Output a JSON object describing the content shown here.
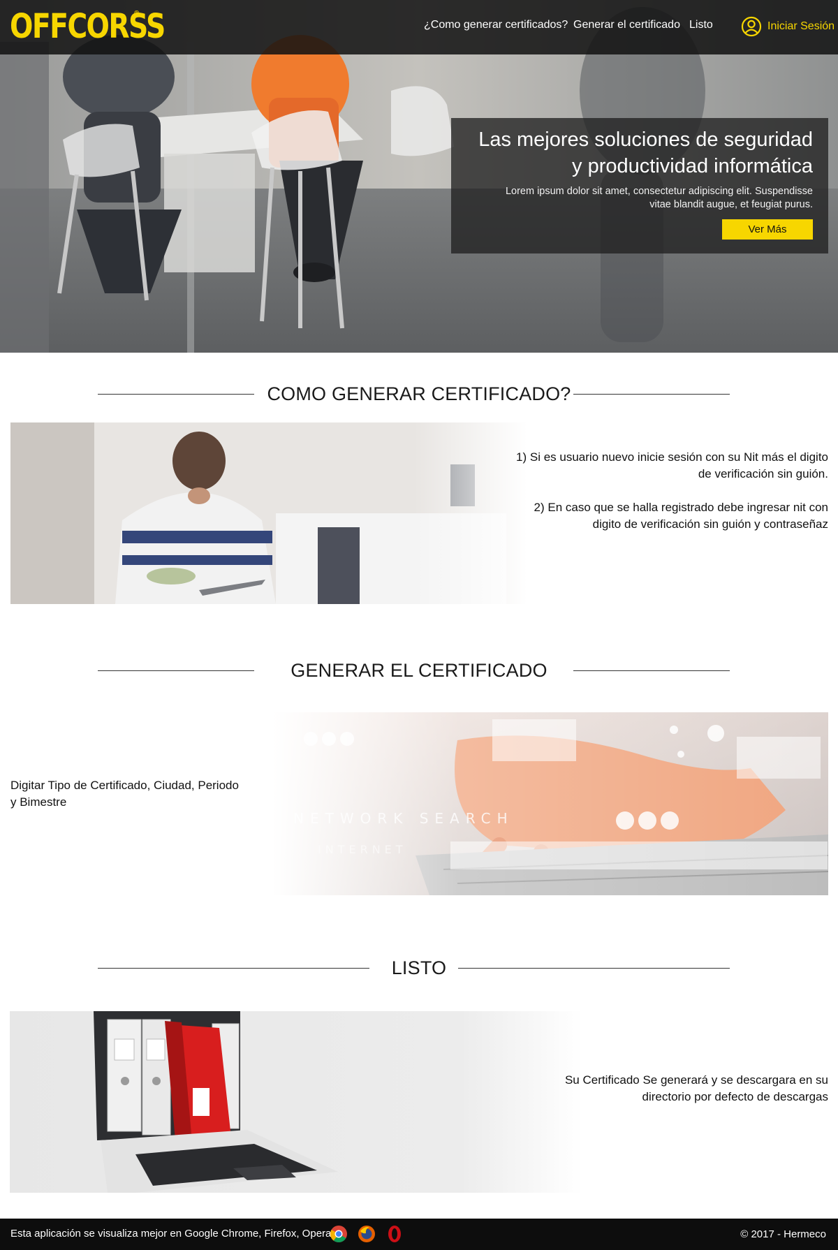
{
  "brand": {
    "logo_text": "OFFCORSS",
    "color": "#f7d600"
  },
  "nav": {
    "items": [
      {
        "label": "¿Como generar certificados?"
      },
      {
        "label": "Generar el certificado"
      },
      {
        "label": "Listo"
      }
    ],
    "login_label": "Iniciar Sesión",
    "login_icon": "user-circle-icon"
  },
  "hero": {
    "title": "Las mejores soluciones de seguridad y productividad informática",
    "text": "Lorem ipsum dolor sit amet, consectetur adipiscing elit. Suspendisse vitae blandit augue, et feugiat purus.",
    "button_label": "Ver Más"
  },
  "sections": {
    "how": {
      "title": "COMO GENERAR CERTIFICADO?",
      "step1": "1) Si es usuario nuevo inicie sesión con su Nit más el digito de verificación sin guión.",
      "step2": "2) En caso que se halla registrado debe ingresar nit con digito de verificación sin guión y contraseñaz"
    },
    "generate": {
      "title": "GENERAR EL CERTIFICADO",
      "text": "Digitar Tipo de Certificado, Ciudad, Periodo y Bimestre",
      "image_label": "NETWORK SEARCH",
      "image_sublabel": "INTERNET"
    },
    "ready": {
      "title": "LISTO",
      "text": "Su Certificado Se generará y se descargara en su directorio por defecto de descargas"
    }
  },
  "footer": {
    "message": "Esta aplicación se visualiza mejor en Google Chrome, Firefox, Opera",
    "browser_icons": [
      "chrome-icon",
      "firefox-icon",
      "opera-icon"
    ],
    "copyright": "© 2017 - Hermeco"
  },
  "colors": {
    "accent": "#f7d600",
    "nav_bg": "#121212",
    "footer_bg": "#0d0d0d"
  }
}
